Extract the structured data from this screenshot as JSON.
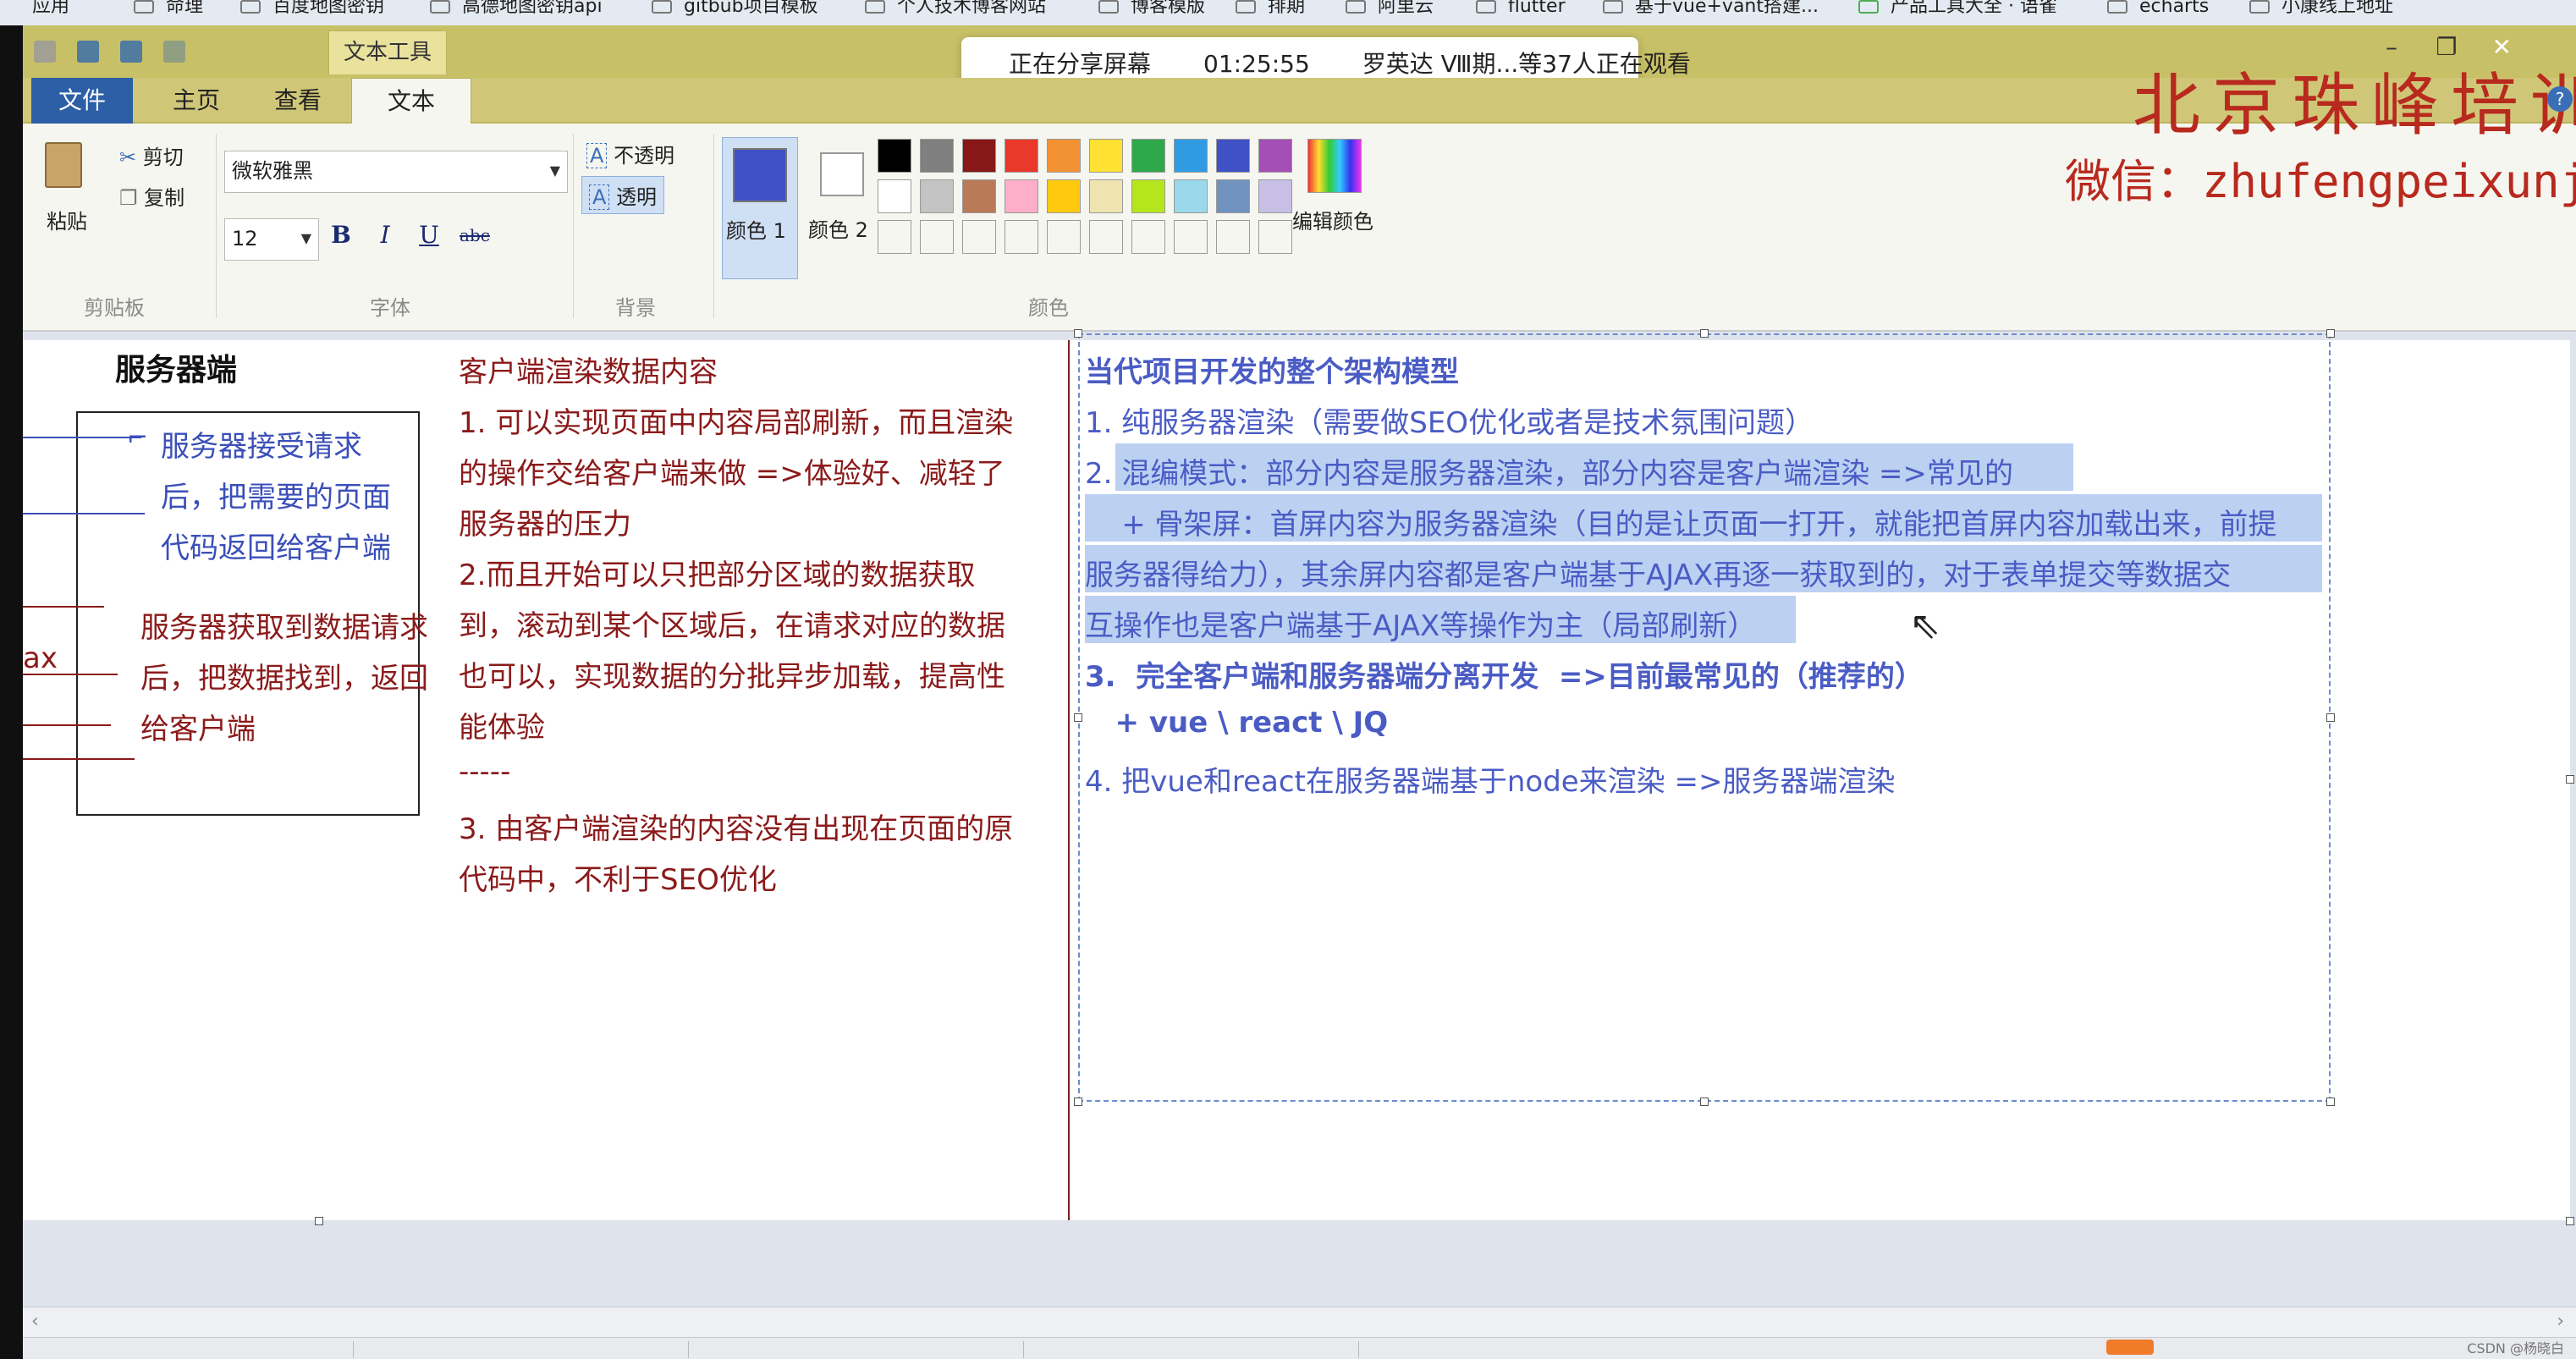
{
  "bookmarks": [
    {
      "label": "应用"
    },
    {
      "label": "命理"
    },
    {
      "label": "百度地图密钥"
    },
    {
      "label": "高德地图密钥api"
    },
    {
      "label": "gitbub项目模板"
    },
    {
      "label": "个人技术博客网站"
    },
    {
      "label": "博客模版"
    },
    {
      "label": "排期"
    },
    {
      "label": "阿里云"
    },
    {
      "label": "flutter"
    },
    {
      "label": "基于vue+vant搭建..."
    },
    {
      "label": "产品工具大全 · 语雀"
    },
    {
      "label": "echarts"
    },
    {
      "label": "小康线上地址"
    }
  ],
  "title_bar": {
    "context_tab": "文本工具",
    "window_controls": {
      "minimize": "–",
      "restore": "❐",
      "close": "✕"
    }
  },
  "share_overlay": {
    "status": "正在分享屏幕",
    "timer": "01:25:55",
    "viewers": "罗英达 Ⅷ期...等37人正在观看"
  },
  "tabs": {
    "file": "文件",
    "home": "主页",
    "view": "查看",
    "text": "文本"
  },
  "ribbon": {
    "clipboard": {
      "paste": "粘贴",
      "cut": "剪切",
      "copy": "复制",
      "group": "剪贴板"
    },
    "font": {
      "family": "微软雅黑",
      "size": "12",
      "bold": "B",
      "italic": "I",
      "underline": "U",
      "strike": "abc",
      "group": "字体"
    },
    "background": {
      "opaque": "不透明",
      "transparent": "透明",
      "group": "背景"
    },
    "colors": {
      "color1": "颜色 1",
      "color2": "颜色 2",
      "edit": "编辑颜色",
      "group": "颜色",
      "color1_value": "#3f51c4",
      "color2_value": "#ffffff",
      "palette_row1": [
        "#000000",
        "#7f7f7f",
        "#881818",
        "#e8392a",
        "#f29233",
        "#ffe133",
        "#2ea84b",
        "#2f9be3",
        "#3f51c4",
        "#a34fb6"
      ],
      "palette_row2": [
        "#ffffff",
        "#c3c3c3",
        "#b97a57",
        "#ffaec9",
        "#ffc90e",
        "#efe4b0",
        "#b5e61d",
        "#99d9ea",
        "#7092be",
        "#c8bfe7"
      ]
    }
  },
  "watermark": {
    "title": "北京珠峰培训",
    "wechat": "微信：zhufengpeixunjiuye"
  },
  "diagram_left": {
    "heading": "服务器端",
    "box_blue": [
      "服务器接受请求",
      "后，把需要的页面",
      "代码返回给客户端"
    ],
    "box_red": [
      "服务器获取到数据请求",
      "后，把数据找到，返回",
      "给客户端"
    ],
    "edge_label": "ax"
  },
  "middle_notes": {
    "heading": "客户端渲染数据内容",
    "lines": [
      "1. 可以实现页面中内容局部刷新，而且渲染",
      "的操作交给客户端来做 =>体验好、减轻了",
      "服务器的压力",
      "2.而且开始可以只把部分区域的数据获取",
      "到，滚动到某个区域后，在请求对应的数据",
      "也可以，实现数据的分批异步加载，提高性",
      "能体验",
      "-----",
      "3. 由客户端渲染的内容没有出现在页面的原",
      "代码中，不利于SEO优化"
    ]
  },
  "right_notes": {
    "heading": "当代项目开发的整个架构模型",
    "line1": "1. 纯服务器渲染（需要做SEO优化或者是技术氛围问题）",
    "line2a": "2. ",
    "line2b": "混编模式：部分内容是服务器渲染，部分内容是客户端渲染    =>常见的",
    "line3": "    + 骨架屏：首屏内容为服务器渲染（目的是让页面一打开，就能把首屏内容加载出来，前提",
    "line4": "服务器得给力），其余屏内容都是客户端基于AJAX再逐一获取到的，对于表单提交等数据交",
    "line5": "互操作也是客户端基于AJAX等操作为主（局部刷新）",
    "line6": "3.  完全客户端和服务器端分离开发  =>目前最常见的（推荐的）",
    "line7": "   + vue \\ react \\ JQ",
    "line8": "4. 把vue和react在服务器端基于node来渲染 =>服务器端渲染"
  },
  "credit": "CSDN @杨晓白"
}
